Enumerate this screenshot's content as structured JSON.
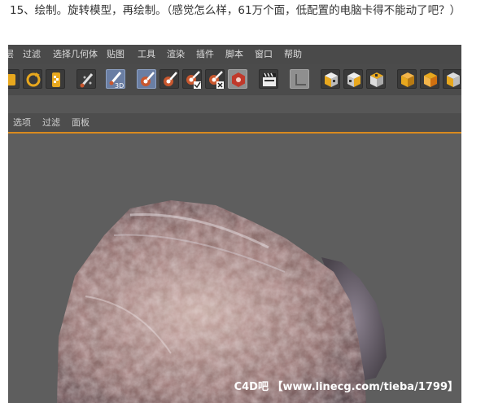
{
  "caption": "15、绘制。旋转模型，再绘制。（感觉怎么样，61万个面，低配置的电脑卡得不能动了吧？）",
  "menu": {
    "items": [
      "层",
      "过滤",
      "选择几何体",
      "贴图",
      "工具",
      "渲染",
      "插件",
      "脚本",
      "窗口",
      "帮助"
    ]
  },
  "toolbar": {
    "buttons": [
      "layer-icon",
      "rotate-icon",
      "checker-icon",
      "brush-icon",
      "paint-3d-icon",
      "paint-icon",
      "paint-icon",
      "paint-check-icon",
      "paint-cross-icon",
      "hex-icon",
      "clapboard-icon",
      "corner-icon",
      "cube-checker-icon",
      "cube-checker-icon",
      "cube-checker-icon",
      "cube-icon",
      "cube-icon",
      "cube-icon"
    ],
    "paint3d_label": "3D"
  },
  "subbar": {
    "items": [
      "选项",
      "过滤",
      "面板"
    ]
  },
  "watermark": {
    "site": "C4D吧",
    "url": "【www.linecg.com/tieba/1799】"
  },
  "colors": {
    "accent": "#d98a1e",
    "menubar": "#4a4a4a",
    "viewport": "#5e5e5e"
  }
}
